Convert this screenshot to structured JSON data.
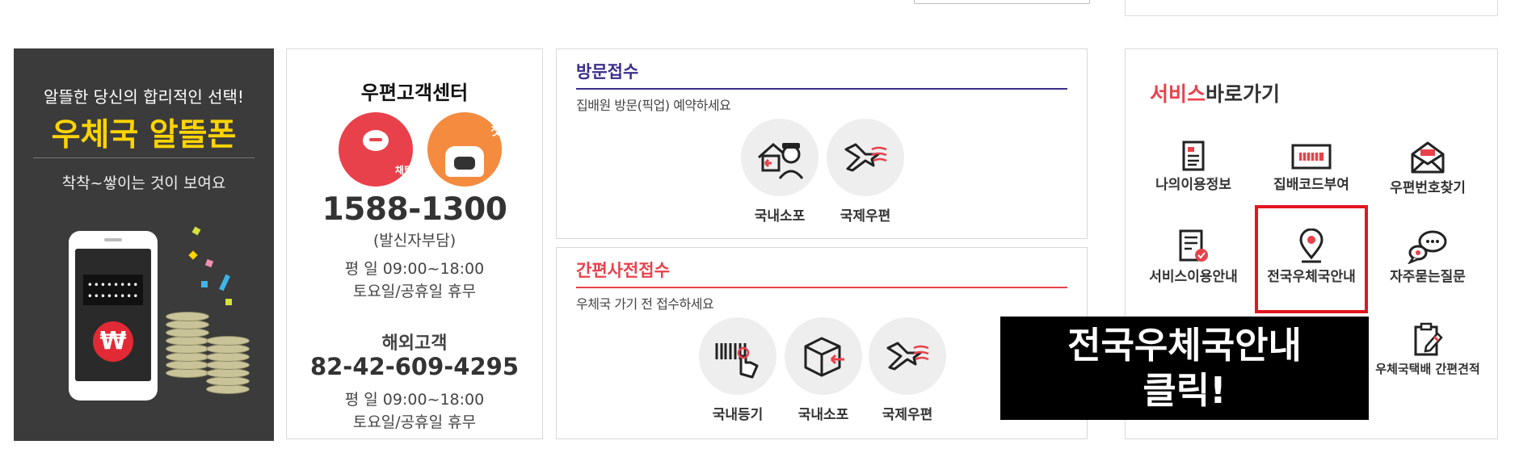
{
  "banner": {
    "tagline": "알뜰한 당신의 합리적인 선택!",
    "brand": "우체국 알뜰폰",
    "subtext": "착착~쌓이는 것이 보여요",
    "phone_dots": "••••••••\n••••••••",
    "currency_symbol": "₩"
  },
  "customer_center": {
    "title": "우편고객센터",
    "chat_label": "채팅상담",
    "chatbot_label": "챗봇",
    "phone": "1588-1300",
    "phone_note": "(발신자부담)",
    "weekday_hours": "평 일     09:00~18:00",
    "weekend_hours": "토요일/공휴일 휴무",
    "overseas_title": "해외고객",
    "overseas_phone": "82-42-609-4295",
    "overseas_weekday_hours": "평 일    09:00~18:00",
    "overseas_weekend_hours": "토요일/공휴일 휴무"
  },
  "visit_pickup": {
    "title": "방문접수",
    "desc": "집배원 방문(픽업) 예약하세요",
    "items": [
      {
        "label": "국내소포",
        "icon": "house-courier-icon"
      },
      {
        "label": "국제우편",
        "icon": "airplane-icon"
      }
    ],
    "color": "#3a2e8c"
  },
  "pre_reception": {
    "title": "간편사전접수",
    "desc": "우체국 가기 전 접수하세요",
    "items": [
      {
        "label": "국내등기",
        "icon": "barcode-hand-icon"
      },
      {
        "label": "국내소포",
        "icon": "parcel-box-icon"
      },
      {
        "label": "국제우편",
        "icon": "airplane-icon"
      }
    ],
    "color": "#e9414b"
  },
  "services": {
    "title_accent": "서비스",
    "title_rest": "바로가기",
    "items": [
      {
        "label": "나의이용정보",
        "icon": "document-list-icon"
      },
      {
        "label": "집배코드부여",
        "icon": "barcode-label-icon"
      },
      {
        "label": "우편번호찾기",
        "icon": "envelope-icon"
      },
      {
        "label": "서비스이용안내",
        "icon": "checklist-icon"
      },
      {
        "label": "전국우체국안내",
        "icon": "location-pin-icon"
      },
      {
        "label": "자주묻는질문",
        "icon": "speech-bubbles-icon"
      },
      {
        "label": "우체국택배 간편견적",
        "icon": "clipboard-pen-icon"
      }
    ],
    "accent_color": "#e9414b"
  },
  "callout": {
    "line1": "전국우체국안내",
    "line2": "클릭!"
  }
}
